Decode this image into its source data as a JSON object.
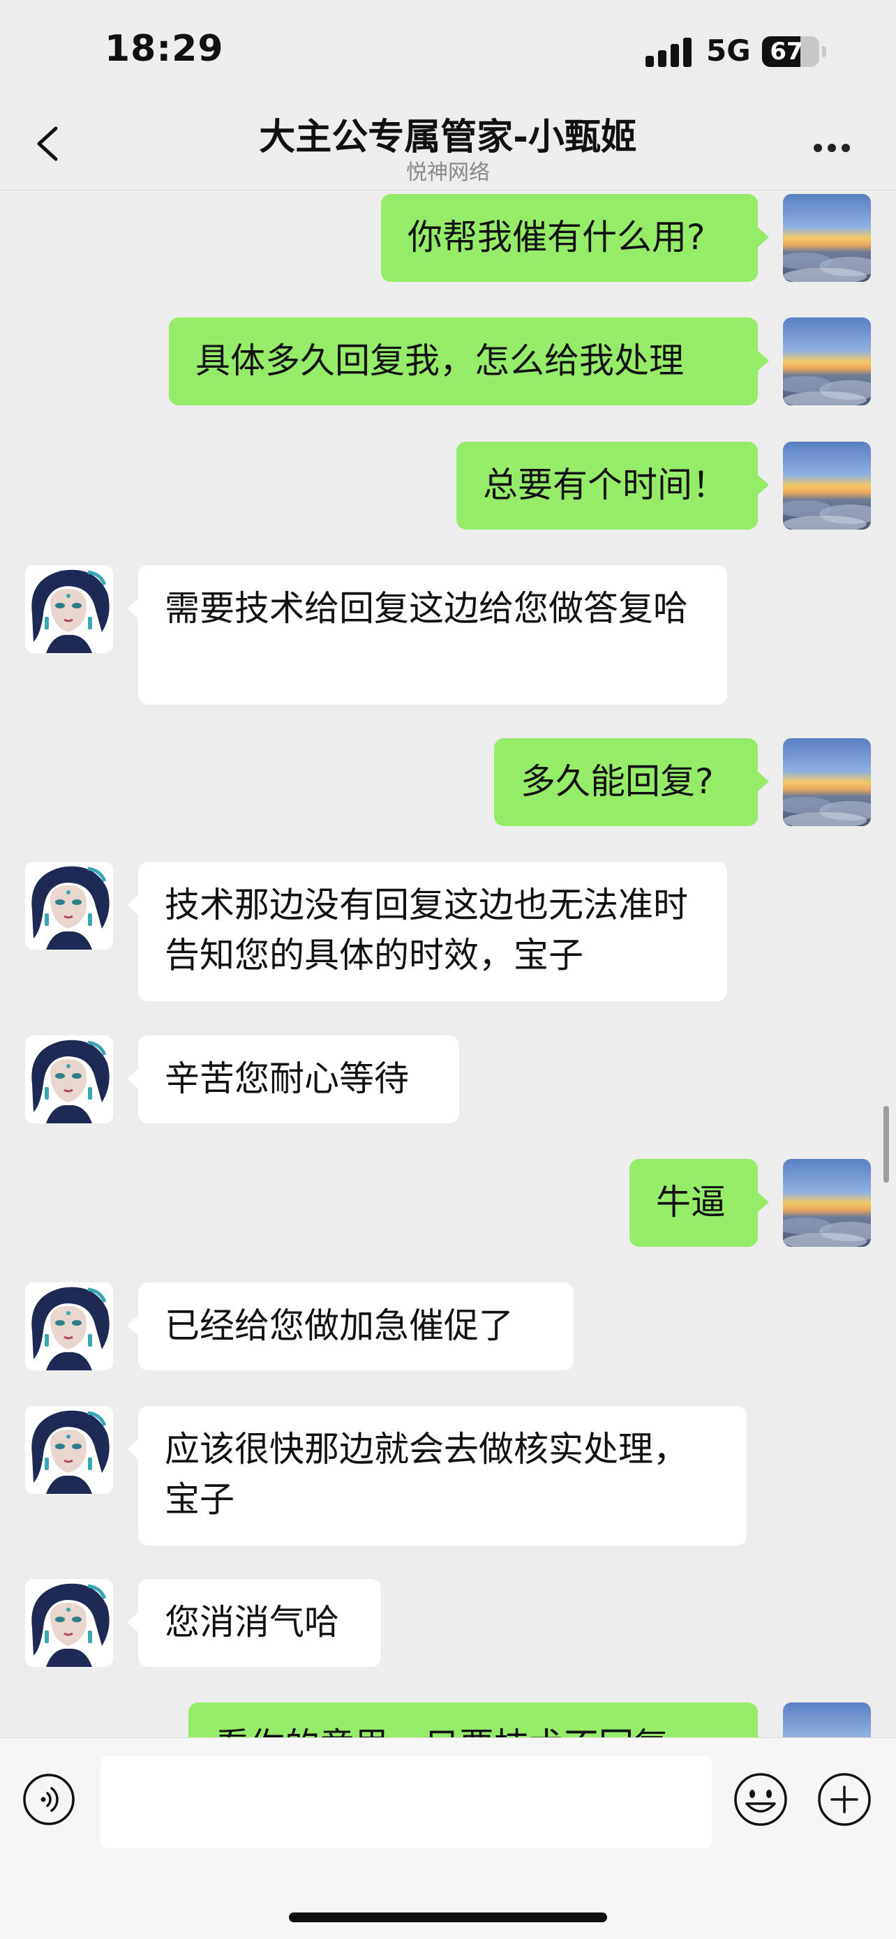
{
  "status_bar": {
    "time": "18:29",
    "network": "5G",
    "battery": "67",
    "battery_level": 0.67
  },
  "header": {
    "title": "大主公专属管家-小甄姬",
    "subtitle": "悦神网络"
  },
  "messages": [
    {
      "sender": "me",
      "text": "你帮我催有什么用?"
    },
    {
      "sender": "me",
      "text": "具体多久回复我，怎么给我处理"
    },
    {
      "sender": "me",
      "text": "总要有个时间！"
    },
    {
      "sender": "them",
      "text": "需要技术给回复这边给您做答复哈"
    },
    {
      "sender": "me",
      "text": "多久能回复?"
    },
    {
      "sender": "them",
      "text": "技术那边没有回复这边也无法准时告知您的具体的时效，宝子"
    },
    {
      "sender": "them",
      "text": "辛苦您耐心等待"
    },
    {
      "sender": "me",
      "text": "牛逼"
    },
    {
      "sender": "them",
      "text": "已经给您做加急催促了"
    },
    {
      "sender": "them",
      "text": "应该很快那边就会去做核实处理，宝子"
    },
    {
      "sender": "them",
      "text": "您消消气哈"
    },
    {
      "sender": "me",
      "text": "看你的意思，只要技术不回复"
    }
  ],
  "input": {
    "value": ""
  },
  "icons": {
    "back": "chevron-left-icon",
    "more": "more-icon",
    "voice": "voice-icon",
    "emoji": "emoji-icon",
    "plus": "plus-icon"
  },
  "colors": {
    "sent_bubble": "#95ec69",
    "received_bubble": "#ffffff",
    "background": "#ededed"
  }
}
